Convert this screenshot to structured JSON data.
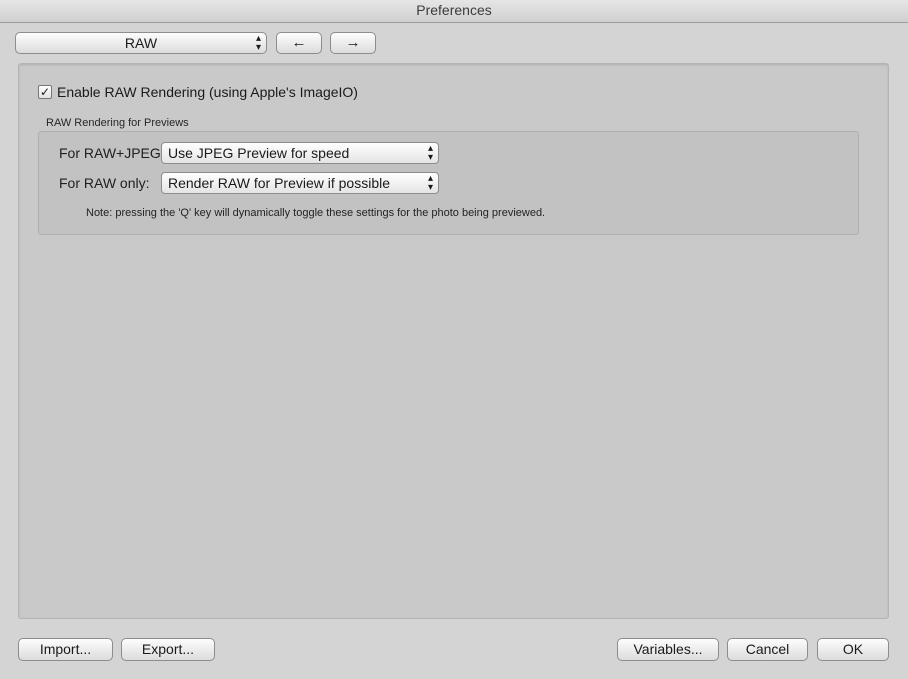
{
  "window": {
    "title": "Preferences"
  },
  "toolbar": {
    "category": "RAW",
    "back_label": "←",
    "forward_label": "→"
  },
  "raw": {
    "enable_checkbox_mark": "☑",
    "enable_label": "Enable RAW Rendering (using Apple's ImageIO)",
    "group_title": "RAW Rendering for Previews",
    "raw_jpeg_label": "For RAW+JPEG:",
    "raw_jpeg_value": "Use JPEG Preview for speed",
    "raw_only_label": "For RAW only:",
    "raw_only_value": "Render RAW for Preview if possible",
    "note": "Note: pressing the 'Q' key will dynamically toggle these settings for the photo being previewed."
  },
  "footer": {
    "import_label": "Import...",
    "export_label": "Export...",
    "variables_label": "Variables...",
    "cancel_label": "Cancel",
    "ok_label": "OK"
  }
}
